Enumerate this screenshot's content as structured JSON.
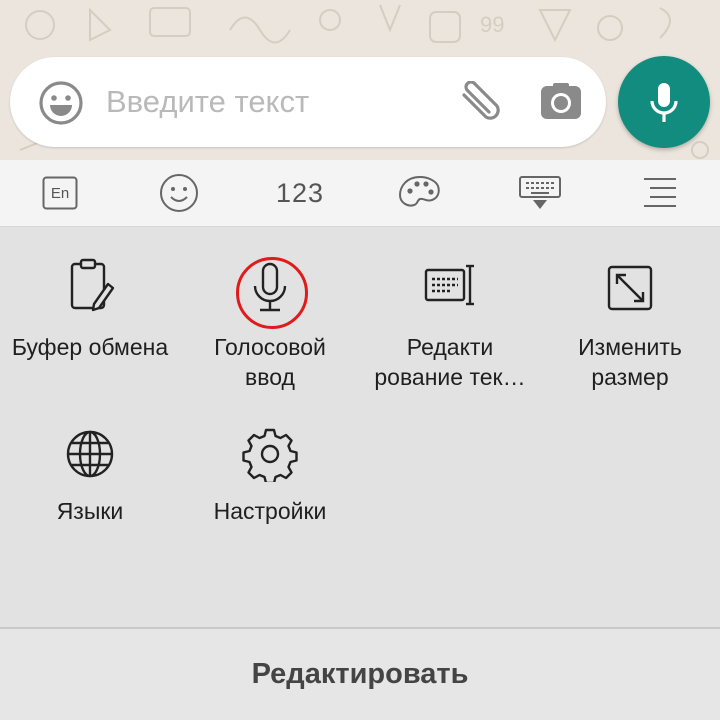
{
  "compose": {
    "placeholder": "Введите текст",
    "emoji_icon": "smiley-icon",
    "attach_icon": "paperclip-icon",
    "camera_icon": "camera-icon",
    "send_icon": "microphone-icon"
  },
  "toolbar": {
    "lang_label": "En",
    "numbers_label": "123",
    "icons": [
      "language-icon",
      "smiley-icon",
      "numbers",
      "palette-icon",
      "keyboard-hide-icon",
      "menu-icon"
    ]
  },
  "panel": {
    "items": [
      {
        "label_line1": "Буфер обмена",
        "label_line2": "",
        "icon": "clipboard-icon"
      },
      {
        "label_line1": "Голосовой",
        "label_line2": "ввод",
        "icon": "microphone-icon"
      },
      {
        "label_line1": "Редакти",
        "label_line2": "рование тек…",
        "icon": "text-edit-icon"
      },
      {
        "label_line1": "Изменить",
        "label_line2": "размер",
        "icon": "resize-icon"
      },
      {
        "label_line1": "Языки",
        "label_line2": "",
        "icon": "globe-icon"
      },
      {
        "label_line1": "Настройки",
        "label_line2": "",
        "icon": "gear-icon"
      }
    ]
  },
  "bottom": {
    "edit_label": "Редактировать"
  },
  "colors": {
    "fab": "#128c7e",
    "highlight": "#e01b1b"
  }
}
